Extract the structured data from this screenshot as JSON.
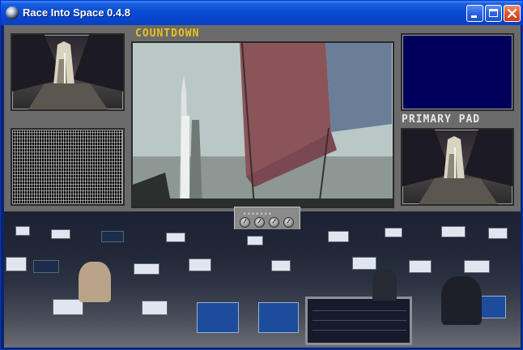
{
  "window": {
    "title": "Race Into Space 0.4.8",
    "controls": {
      "minimize": "minimize",
      "maximize": "maximize",
      "close": "close"
    }
  },
  "labels": {
    "countdown": "COUNTDOWN",
    "primary_pad": "PRIMARY PAD"
  },
  "icons": {
    "app": "globe-icon",
    "minimize": "minimize-icon",
    "maximize": "maximize-icon",
    "close": "close-icon"
  },
  "colors": {
    "countdown_label": "#e8c21e",
    "pad_label": "#e6e6e6",
    "blank_monitor": "#00005c",
    "titlebar": "#0a4fd6",
    "close_button": "#e0552c"
  }
}
